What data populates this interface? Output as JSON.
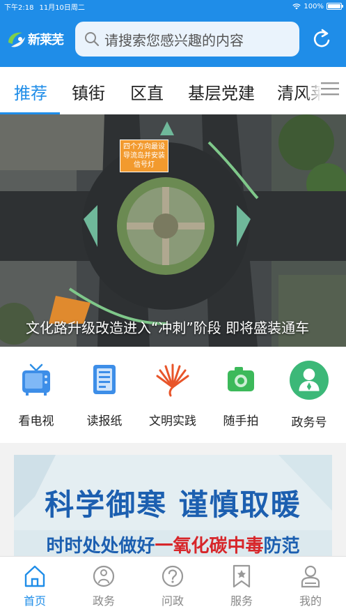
{
  "status_bar": {
    "time": "下午2:18",
    "date": "11月10日周二",
    "battery": "100%",
    "battery_level": 1.0
  },
  "header": {
    "logo_text": "新莱芜",
    "search_placeholder": "请搜索您感兴趣的内容"
  },
  "tabs": [
    {
      "label": "推荐",
      "active": true
    },
    {
      "label": "镇街",
      "active": false
    },
    {
      "label": "区直",
      "active": false
    },
    {
      "label": "基层党建",
      "active": false
    },
    {
      "label": "清风莱",
      "active": false
    }
  ],
  "banner": {
    "caption": "文化路升级改造进入“冲刺”阶段 即将盛装通车",
    "sign_text": "四个方向最设导流岛并安装信号灯"
  },
  "services": [
    {
      "label": "看电视",
      "icon": "tv-icon"
    },
    {
      "label": "读报纸",
      "icon": "newspaper-icon"
    },
    {
      "label": "文明实践",
      "icon": "civilization-practice-icon"
    },
    {
      "label": "随手拍",
      "icon": "camera-icon"
    },
    {
      "label": "政务号",
      "icon": "government-account-icon"
    }
  ],
  "notice_card": {
    "title": "科学御寒  谨慎取暖",
    "subtitle_pre": "时时处处做好",
    "subtitle_highlight": "一氧化碳中毒",
    "subtitle_post": "防范"
  },
  "bottom_nav": [
    {
      "label": "首页",
      "icon": "home-icon",
      "active": true
    },
    {
      "label": "政务",
      "icon": "government-icon",
      "active": false
    },
    {
      "label": "问政",
      "icon": "question-icon",
      "active": false
    },
    {
      "label": "服务",
      "icon": "service-bookmark-icon",
      "active": false
    },
    {
      "label": "我的",
      "icon": "profile-icon",
      "active": false
    }
  ],
  "colors": {
    "primary": "#1f8de8",
    "card_text": "#1c5fb0",
    "highlight": "#d7262a"
  }
}
